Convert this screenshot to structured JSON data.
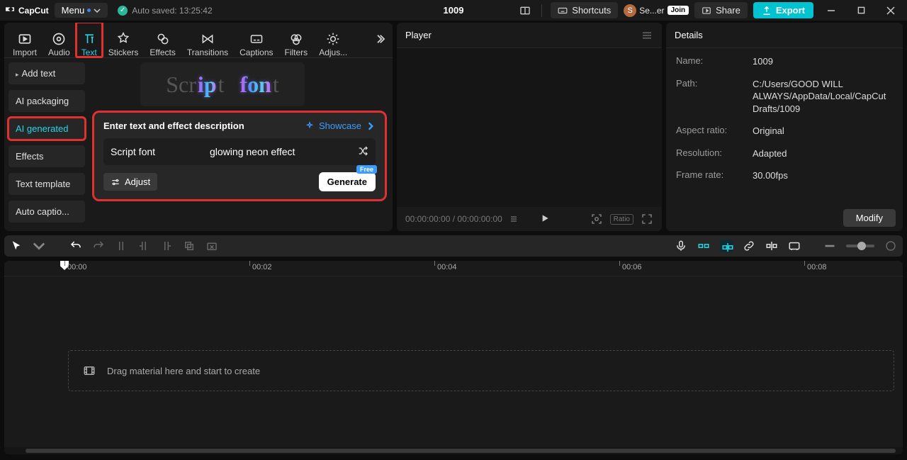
{
  "titlebar": {
    "brand": "CapCut",
    "menu": "Menu",
    "autosave": "Auto saved: 13:25:42",
    "title": "1009",
    "shortcuts": "Shortcuts",
    "user_abbrev": "Se...er",
    "join": "Join",
    "share": "Share",
    "export": "Export"
  },
  "tabs": {
    "import": "Import",
    "audio": "Audio",
    "text": "Text",
    "stickers": "Stickers",
    "effects": "Effects",
    "transitions": "Transitions",
    "captions": "Captions",
    "filters": "Filters",
    "adjust": "Adjus..."
  },
  "sidebar": {
    "add_text": "Add text",
    "ai_packaging": "AI packaging",
    "ai_generated": "AI generated",
    "effects": "Effects",
    "text_template": "Text template",
    "auto_captions": "Auto captio..."
  },
  "ai": {
    "prompt_title": "Enter text and effect description",
    "showcase": "Showcase",
    "input_font": "Script font",
    "input_effect": "glowing neon effect",
    "adjust": "Adjust",
    "generate": "Generate",
    "free": "Free"
  },
  "preview": {
    "line1_a": "Scr",
    "line1_b": "ip",
    "line1_c": "t",
    "line1_d": "fon",
    "line1_e": "t"
  },
  "player": {
    "title": "Player",
    "time": "00:00:00:00 / 00:00:00:00",
    "ratio": "Ratio"
  },
  "details": {
    "title": "Details",
    "name_k": "Name:",
    "name_v": "1009",
    "path_k": "Path:",
    "path_v": "C:/Users/GOOD WILL ALWAYS/AppData/Local/CapCut Drafts/1009",
    "aspect_k": "Aspect ratio:",
    "aspect_v": "Original",
    "res_k": "Resolution:",
    "res_v": "Adapted",
    "fps_k": "Frame rate:",
    "fps_v": "30.00fps",
    "modify": "Modify"
  },
  "timeline": {
    "t0": "00:00",
    "t1": "00:02",
    "t2": "00:04",
    "t3": "00:06",
    "t4": "00:08",
    "drop_hint": "Drag material here and start to create"
  }
}
